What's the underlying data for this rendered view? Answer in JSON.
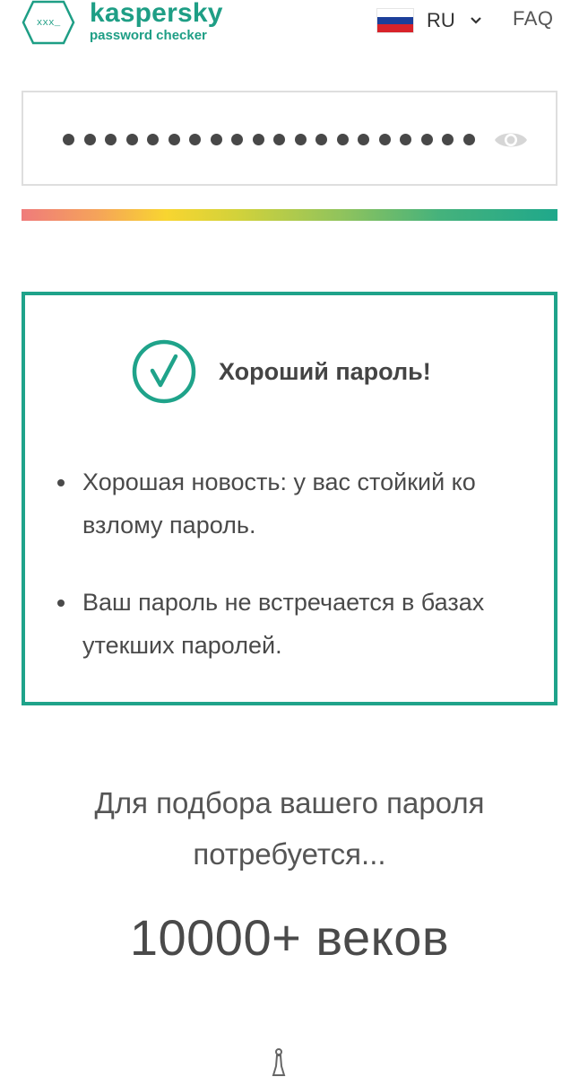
{
  "header": {
    "brand": "kaspersky",
    "product": "password checker",
    "logo_mark_text": "xxx_",
    "language_code": "RU",
    "language_flag": "russia-flag",
    "faq_label": "FAQ"
  },
  "password_field": {
    "masked_length": 20,
    "visibility_icon": "eye-icon"
  },
  "strength_meter": {
    "level": "strong",
    "fill_percent": 100
  },
  "result": {
    "icon": "check-circle-icon",
    "title": "Хороший пароль!",
    "items": [
      {
        "text": "Хорошая новость: у вас стойкий ко взлому пароль."
      },
      {
        "text": "Ваш пароль не встречается в базах утекших паролей."
      }
    ]
  },
  "crack_time": {
    "intro": "Для подбора вашего пароля потребуется...",
    "value": "10000+ веков"
  },
  "colors": {
    "accent": "#1fa38a",
    "text": "#444444",
    "border": "#dedede"
  }
}
